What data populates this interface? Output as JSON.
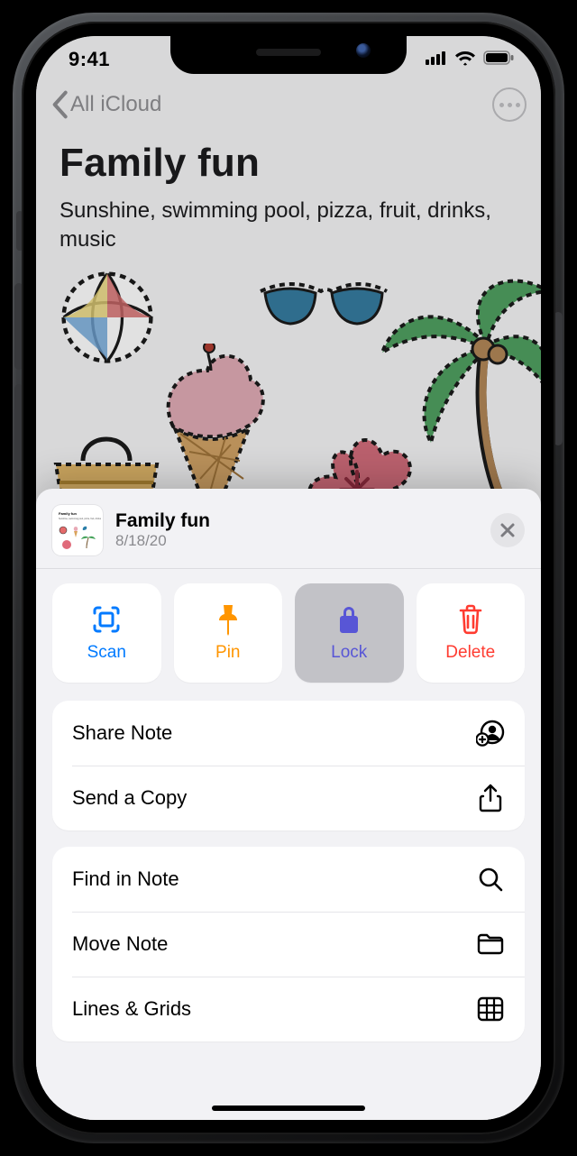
{
  "status": {
    "time": "9:41"
  },
  "nav": {
    "back_label": "All iCloud"
  },
  "note": {
    "title": "Family fun",
    "body": "Sunshine, swimming pool, pizza, fruit, drinks, music"
  },
  "sheet": {
    "title": "Family fun",
    "date": "8/18/20",
    "quick": {
      "scan": "Scan",
      "pin": "Pin",
      "lock": "Lock",
      "delete": "Delete"
    },
    "rows": {
      "share": "Share Note",
      "send": "Send a Copy",
      "find": "Find in Note",
      "move": "Move Note",
      "lines": "Lines & Grids"
    }
  },
  "colors": {
    "blue": "#007aff",
    "orange": "#ff9500",
    "purple": "#5856d6",
    "red": "#ff3b30",
    "sheet_bg": "#f2f2f5"
  }
}
